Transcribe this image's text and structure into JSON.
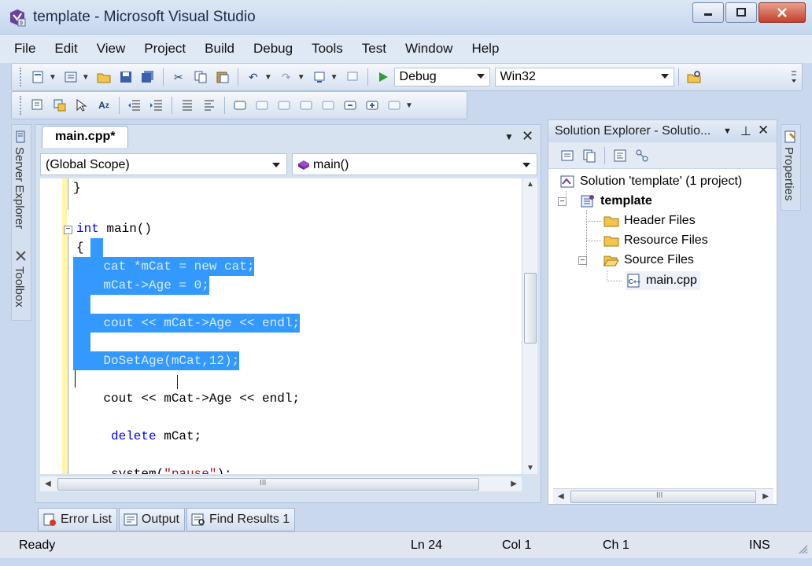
{
  "window": {
    "title": "template - Microsoft Visual Studio",
    "icons": {
      "app": "visual-studio-icon",
      "minimize": "minimize-icon",
      "maximize": "maximize-icon",
      "close": "close-icon"
    }
  },
  "menu": {
    "items": [
      "File",
      "Edit",
      "View",
      "Project",
      "Build",
      "Debug",
      "Tools",
      "Test",
      "Window",
      "Help"
    ]
  },
  "toolbar": {
    "configuration": "Debug",
    "platform": "Win32",
    "start_icon": "start-debugging-icon"
  },
  "side_tabs": {
    "left": [
      "Server Explorer",
      "Toolbox"
    ],
    "right": [
      "Properties"
    ]
  },
  "editor": {
    "tab_label": "main.cpp*",
    "scope": "(Global Scope)",
    "member": "main()",
    "lines": {
      "l1": "}",
      "l2_kw": "int",
      "l2_rest": " main()",
      "l3": "{",
      "l4": "    cat *mCat = new cat;",
      "l5": "    mCat->Age = 0;",
      "l6": "    cout << mCat->Age << endl;",
      "l7": "    DoSetAge(mCat,12);",
      "l8": "    cout << mCat->Age << endl;",
      "l9_kw": "delete",
      "l9_rest": " mCat;",
      "l10_a": "system(",
      "l10_str": "\"pause\"",
      "l10_b": ");"
    },
    "scroll_marker": "III"
  },
  "solution_explorer": {
    "title": "Solution Explorer - Solutio...",
    "solution": "Solution 'template' (1 project)",
    "project": "template",
    "folders": [
      "Header Files",
      "Resource Files",
      "Source Files"
    ],
    "file": "main.cpp",
    "scroll_marker": "III"
  },
  "bottom_tabs": [
    "Error List",
    "Output",
    "Find Results 1"
  ],
  "status": {
    "text": "Ready",
    "line": "Ln 24",
    "col": "Col 1",
    "ch": "Ch 1",
    "mode": "INS"
  },
  "colors": {
    "selection": "#3399ff",
    "keyword": "#0000ff",
    "string": "#a31515",
    "change_bar": "#fff6a8"
  }
}
